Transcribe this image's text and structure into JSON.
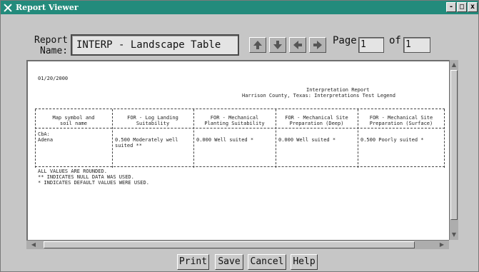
{
  "window": {
    "title": "Report Viewer",
    "controls": [
      "-",
      "□",
      "x"
    ]
  },
  "report_name": {
    "label_line1": "Report",
    "label_line2": "Name:",
    "value": "INTERP - Landscape Table"
  },
  "nav": {
    "icons": [
      "arrow-up-icon",
      "arrow-down-icon",
      "arrow-left-icon",
      "arrow-right-icon"
    ]
  },
  "page": {
    "label": "Page",
    "current": "1",
    "of_label": "of",
    "total": "1"
  },
  "report": {
    "date": "01/20/2000",
    "title_line1": "Interpretation Report",
    "title_line2": "Harrison County, Texas: Interpretations Test Legend",
    "columns": [
      [
        "Map symbol and",
        "soil name"
      ],
      [
        "FOR - Log Landing",
        "Suitability"
      ],
      [
        "FOR - Mechanical",
        "Planting Suitability"
      ],
      [
        "FOR - Mechanical Site",
        "Preparation (Deep)"
      ],
      [
        "FOR - Mechanical Site",
        "Preparation (Surface)"
      ]
    ],
    "row": {
      "map_symbol": "CbA:",
      "soil_name": "Adena",
      "cells": [
        [
          "0.500 Moderately well",
          "suited **"
        ],
        [
          "0.000 Well suited *"
        ],
        [
          "0.000 Well suited *"
        ],
        [
          "0.500 Poorly suited *"
        ]
      ]
    },
    "footnotes": [
      "ALL VALUES ARE ROUNDED.",
      "** INDICATES NULL DATA WAS USED.",
      "* INDICATES DEFAULT VALUES WERE USED."
    ]
  },
  "buttons": {
    "print": "Print",
    "save": "Save",
    "cancel": "Cancel",
    "help": "Help"
  },
  "colors": {
    "titlebar": "#238b7c",
    "window_bg": "#c6c6c6",
    "viewer_bg": "#ffffff"
  }
}
